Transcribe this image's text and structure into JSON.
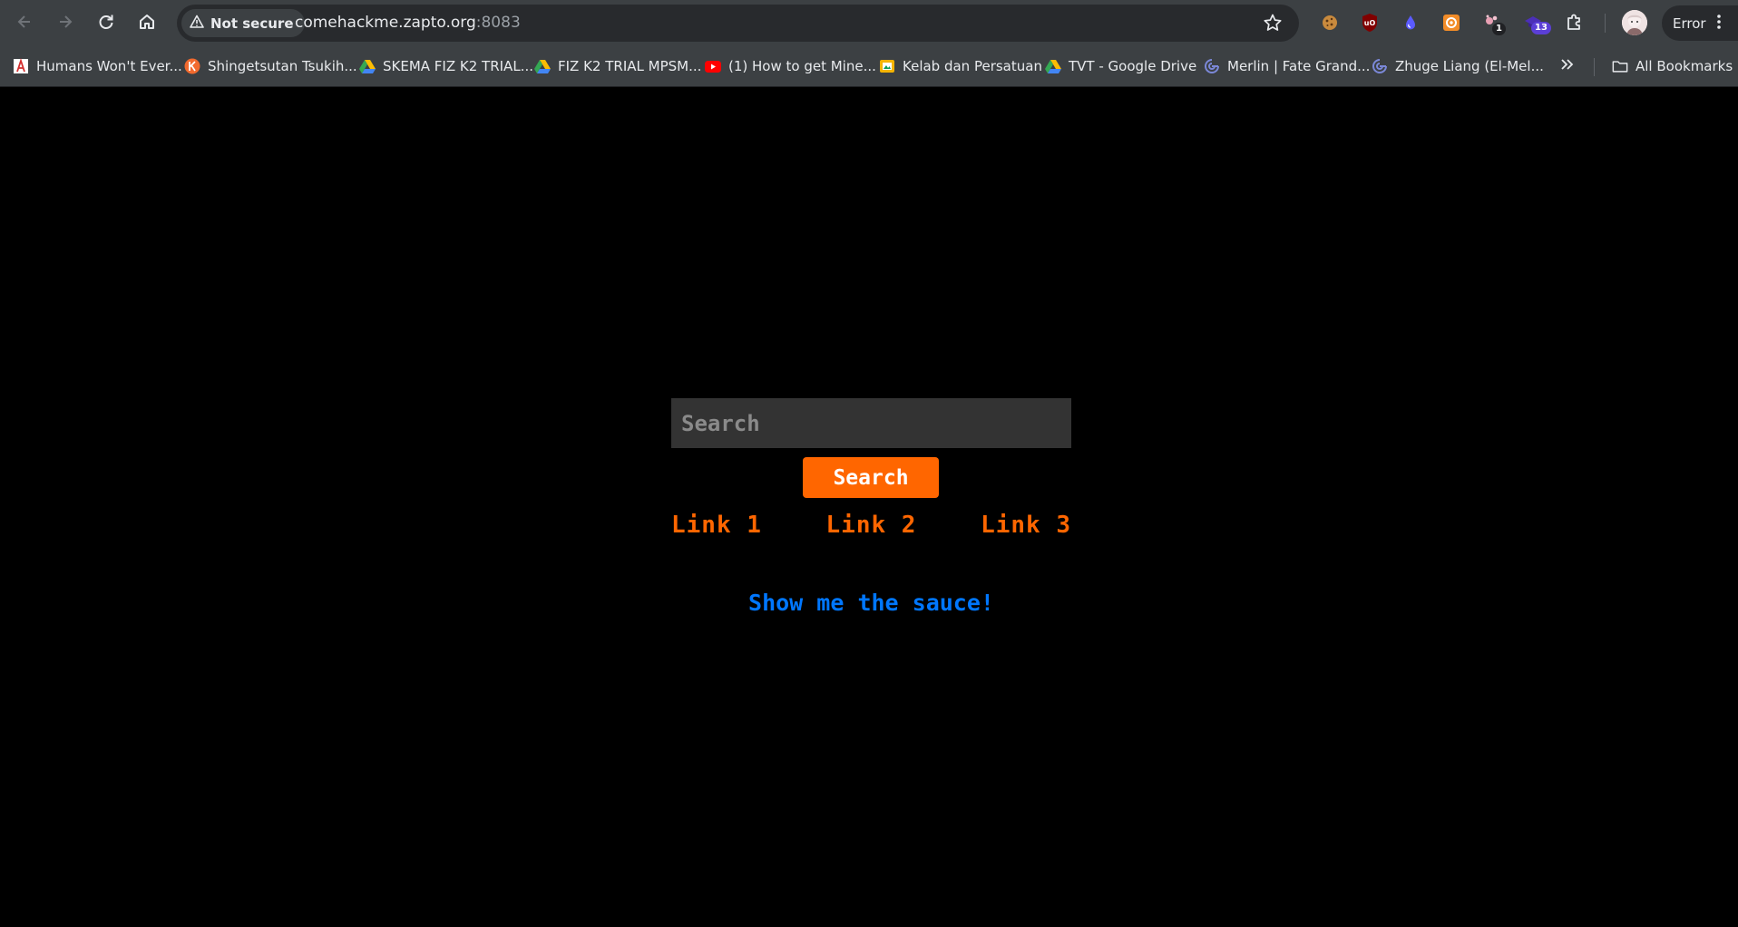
{
  "browser": {
    "security_label": "Not secure",
    "url_host": "comehackme.zapto.org",
    "url_port": ":8083",
    "profile_status": "Error",
    "extensions": [
      {
        "name": "cookie-extension"
      },
      {
        "name": "ublock-extension"
      },
      {
        "name": "droplet-extension"
      },
      {
        "name": "orange-square-extension"
      },
      {
        "name": "dots-extension",
        "badge": "1"
      },
      {
        "name": "hat-extension",
        "badge": "13"
      }
    ]
  },
  "bookmarks": {
    "items": [
      {
        "label": "Humans Won't Ever...",
        "icon": "pdf-icon"
      },
      {
        "label": "Shingetsutan Tsukih...",
        "icon": "kitsu-icon"
      },
      {
        "label": "SKEMA FIZ K2 TRIAL...",
        "icon": "google-drive-icon"
      },
      {
        "label": "FIZ K2 TRIAL MPSM...",
        "icon": "google-drive-icon"
      },
      {
        "label": "(1) How to get Mine...",
        "icon": "youtube-icon"
      },
      {
        "label": "Kelab dan Persatuan",
        "icon": "google-slides-icon"
      },
      {
        "label": "TVT - Google Drive",
        "icon": "google-drive-icon"
      },
      {
        "label": "Merlin | Fate Grand...",
        "icon": "fandom-icon"
      },
      {
        "label": "Zhuge Liang (El-Mel...",
        "icon": "fandom-icon"
      }
    ],
    "all_bookmarks_label": "All Bookmarks"
  },
  "page": {
    "search_placeholder": "Search",
    "search_button_label": "Search",
    "links": [
      "Link 1",
      "Link 2",
      "Link 3"
    ],
    "sauce_link": "Show me the sauce!"
  },
  "colors": {
    "accent_orange": "#ff6600",
    "sauce_blue": "#0077ff",
    "page_background": "#000000"
  }
}
